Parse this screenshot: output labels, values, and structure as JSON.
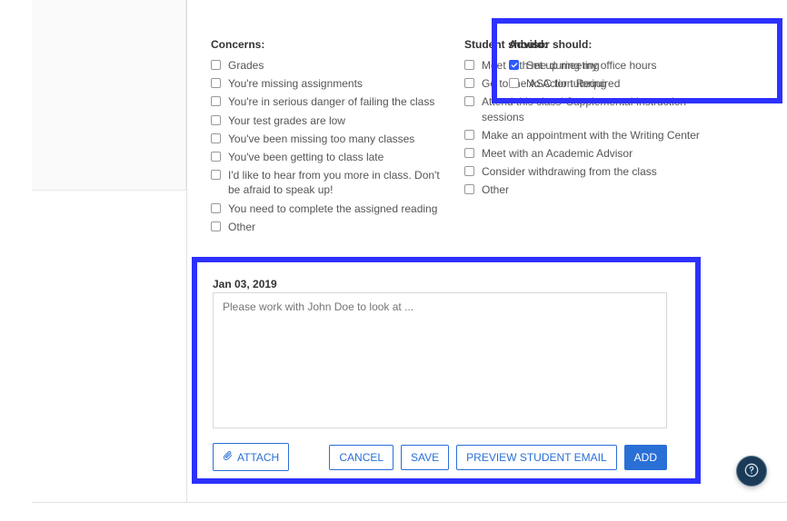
{
  "concerns": {
    "header": "Concerns:",
    "items": [
      "Grades",
      "You're missing assignments",
      "You're in serious danger of failing the class",
      "Your test grades are low",
      "You've been missing too many classes",
      "You've been getting to class late",
      "I'd like to hear from you more in class. Don't be afraid to speak up!",
      "You need to complete the assigned reading",
      "Other"
    ]
  },
  "student_should": {
    "header": "Student should:",
    "items": [
      "Meet with me during my office hours",
      "Go to the ASC for tutoring",
      "Attend this class' Supplemental Instruction sessions",
      "Make an appointment with the Writing Center",
      "Meet with an Academic Advisor",
      "Consider withdrawing from the class",
      "Other"
    ]
  },
  "advisor_should": {
    "header": "Advisor should:",
    "items": [
      {
        "label": "Set up meeting",
        "checked": true
      },
      {
        "label": "No Action Required",
        "checked": false
      }
    ]
  },
  "note": {
    "date": "Jan 03, 2019",
    "placeholder": "Please work with John Doe to look at ..."
  },
  "buttons": {
    "attach": "ATTACH",
    "cancel": "CANCEL",
    "save": "SAVE",
    "preview": "PREVIEW STUDENT EMAIL",
    "add": "ADD"
  }
}
